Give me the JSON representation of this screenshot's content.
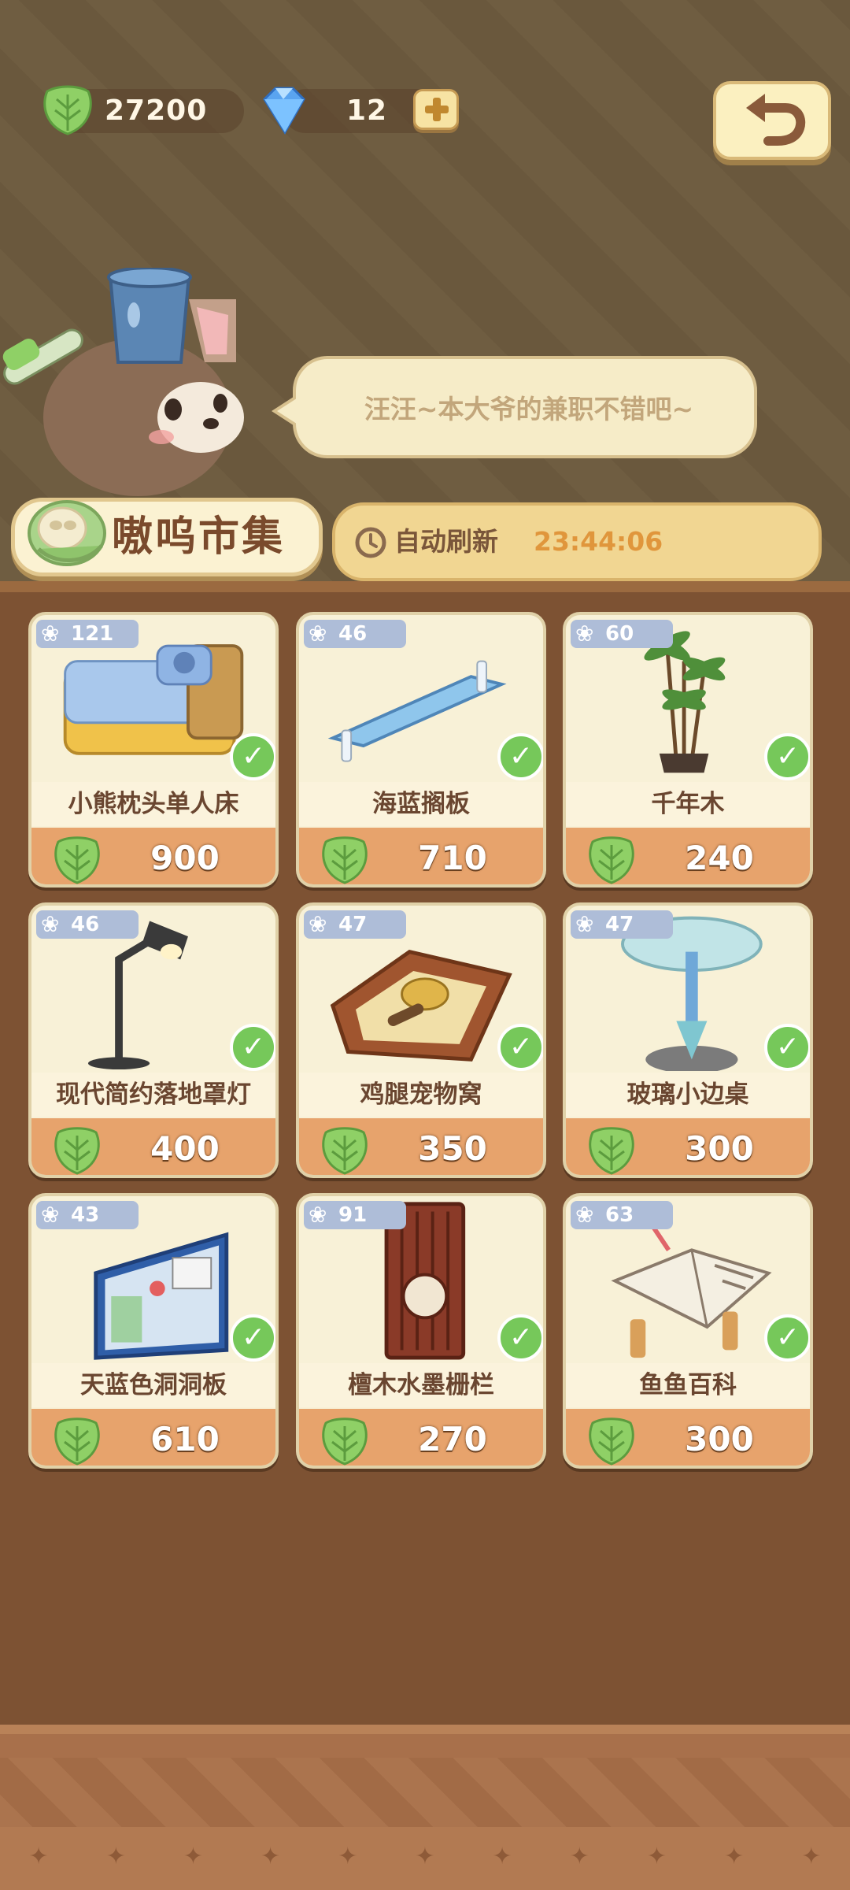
{
  "header": {
    "leaf_amount": "27200",
    "gem_amount": "12"
  },
  "speech": {
    "text": "汪汪~本大爷的兼职不错吧~"
  },
  "market": {
    "title": "嗷呜市集",
    "refresh_label": "自动刷新",
    "refresh_timer": "23:44:06"
  },
  "items": [
    {
      "rank": "121",
      "name": "小熊枕头单人床",
      "price": "900",
      "owned": true,
      "icon": "bed-icon"
    },
    {
      "rank": "46",
      "name": "海蓝搁板",
      "price": "710",
      "owned": true,
      "icon": "shelf-icon"
    },
    {
      "rank": "60",
      "name": "千年木",
      "price": "240",
      "owned": true,
      "icon": "plant-icon"
    },
    {
      "rank": "46",
      "name": "现代简约落地罩灯",
      "price": "400",
      "owned": true,
      "icon": "floor-lamp-icon"
    },
    {
      "rank": "47",
      "name": "鸡腿宠物窝",
      "price": "350",
      "owned": true,
      "icon": "pet-bed-icon"
    },
    {
      "rank": "47",
      "name": "玻璃小边桌",
      "price": "300",
      "owned": true,
      "icon": "glass-table-icon"
    },
    {
      "rank": "43",
      "name": "天蓝色洞洞板",
      "price": "610",
      "owned": true,
      "icon": "pegboard-icon"
    },
    {
      "rank": "91",
      "name": "檀木水墨栅栏",
      "price": "270",
      "owned": true,
      "icon": "wood-screen-icon"
    },
    {
      "rank": "63",
      "name": "鱼鱼百科",
      "price": "300",
      "owned": true,
      "icon": "book-icon"
    }
  ],
  "colors": {
    "leaf": "#8fd066",
    "accent_orange": "#e0963c",
    "price_bar": "#e7a36c",
    "check_green": "#76c85a"
  }
}
